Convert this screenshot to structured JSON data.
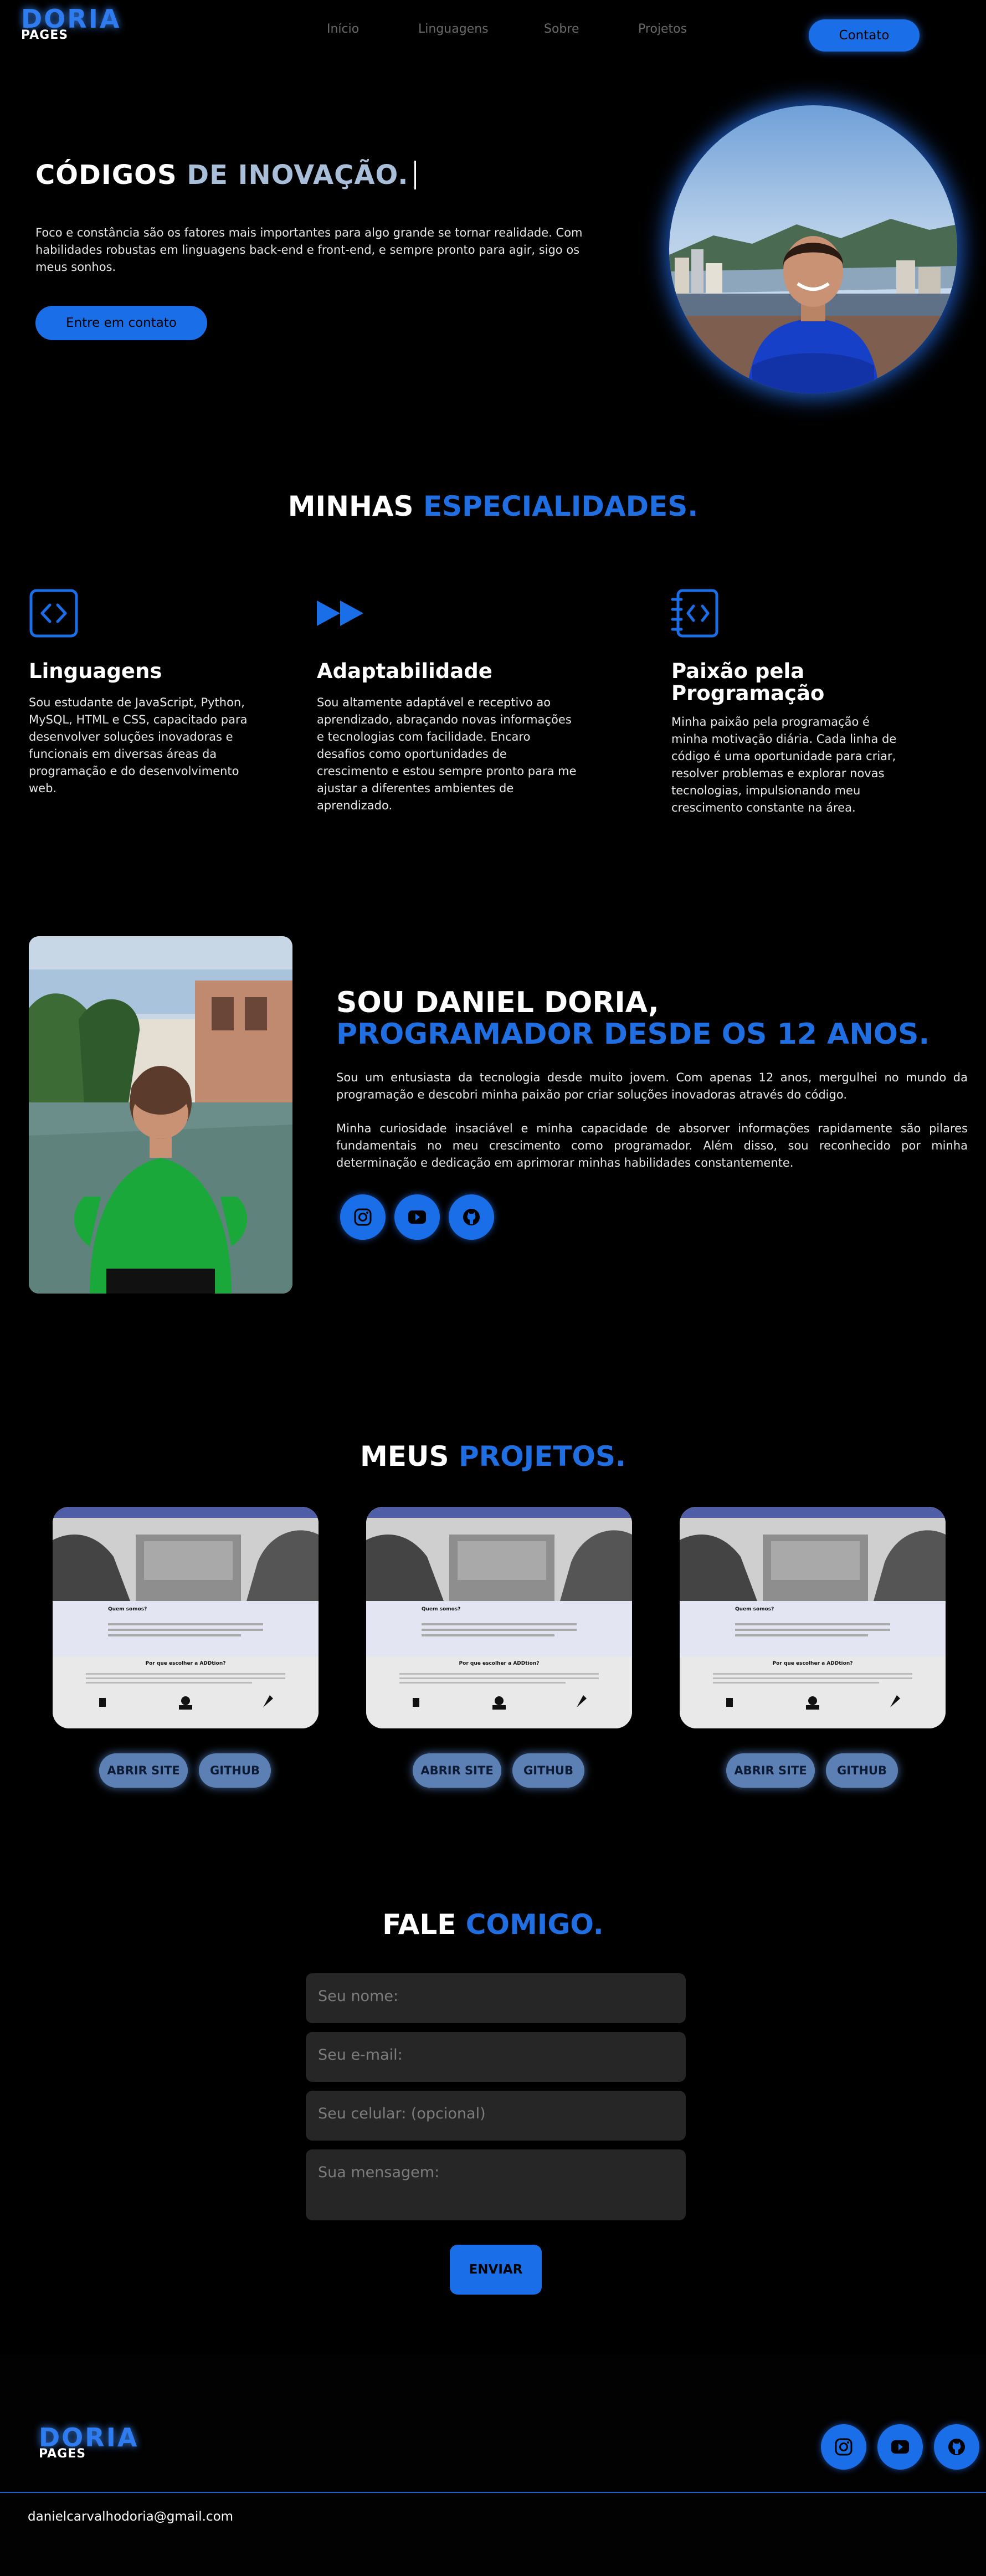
{
  "brand": {
    "logo_main": "DORIA",
    "logo_sub": "PAGES"
  },
  "nav": {
    "items": [
      "Início",
      "Linguagens",
      "Sobre",
      "Projetos"
    ],
    "contact_label": "Contato"
  },
  "hero": {
    "title_white": "CÓDIGOS",
    "title_accent": "DE INOVAÇÃO.",
    "text": "Foco e constância são os fatores mais importantes para algo grande se tornar realidade. Com habilidades robustas em linguagens back-end e front-end, e sempre pronto para agir, sigo os meus sonhos.",
    "cta_label": "Entre em contato"
  },
  "specialties": {
    "heading_white": "MINHAS",
    "heading_accent": "ESPECIALIDADES.",
    "items": [
      {
        "icon": "code-icon",
        "title": "Linguagens",
        "text": "Sou estudante de JavaScript, Python, MySQL, HTML e CSS, capacitado para desenvolver soluções inovadoras e funcionais em diversas áreas da programação e do desenvolvimento web."
      },
      {
        "icon": "fast-forward-icon",
        "title": "Adaptabilidade",
        "text": "Sou altamente adaptável e receptivo ao aprendizado, abraçando novas informações e tecnologias com facilidade. Encaro desafios como oportunidades de crescimento e estou sempre pronto para me ajustar a diferentes ambientes de aprendizado."
      },
      {
        "icon": "code-notebook-icon",
        "title": "Paixão pela Programação",
        "text": "Minha paixão pela programação é minha motivação diária. Cada linha de código é uma oportunidade para criar, resolver problemas e explorar novas tecnologias, impulsionando meu crescimento constante na área."
      }
    ]
  },
  "about": {
    "line1": "SOU DANIEL DORIA,",
    "line2": "PROGRAMADOR DESDE OS 12 ANOS.",
    "p1": "Sou um entusiasta da tecnologia desde muito jovem. Com apenas 12 anos, mergulhei no mundo da programação e descobri minha paixão por criar soluções inovadoras através do código.",
    "p2": "Minha curiosidade insaciável e minha capacidade de absorver informações rapidamente são pilares fundamentais no meu crescimento como programador. Além disso, sou reconhecido por minha determinação e dedicação em aprimorar minhas habilidades constantemente.",
    "socials": [
      "instagram-icon",
      "youtube-icon",
      "github-icon"
    ]
  },
  "projects": {
    "heading_white": "MEUS",
    "heading_accent": "PROJETOS.",
    "open_label": "ABRIR SITE",
    "github_label": "GITHUB",
    "cards": [
      {
        "preview_heading": "Quem somos?",
        "preview_sub": "Por que escolher a ADDtion?"
      },
      {
        "preview_heading": "Quem somos?",
        "preview_sub": "Por que escolher a ADDtion?"
      },
      {
        "preview_heading": "Quem somos?",
        "preview_sub": "Por que escolher a ADDtion?"
      }
    ]
  },
  "contact": {
    "heading_white": "FALE",
    "heading_accent": "COMIGO.",
    "name_placeholder": "Seu nome:",
    "email_placeholder": "Seu e-mail:",
    "phone_placeholder": "Seu celular: (opcional)",
    "message_placeholder": "Sua mensagem:",
    "send_label": "ENVIAR"
  },
  "footer": {
    "logo_main": "DORIA",
    "logo_sub": "PAGES",
    "email": "danielcarvalhodoria@gmail.com",
    "socials": [
      "instagram-icon",
      "youtube-icon",
      "github-icon"
    ]
  },
  "colors": {
    "accent": "#1a6fe8",
    "accent_light": "#a9bed9",
    "background": "#000000",
    "field": "#262626"
  }
}
